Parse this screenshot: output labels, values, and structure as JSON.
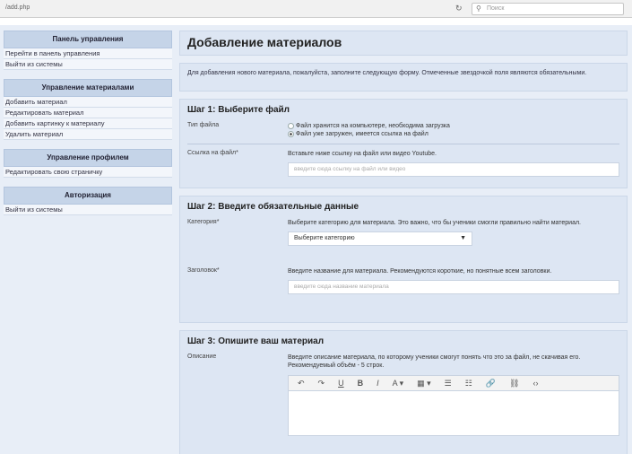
{
  "addressbar": {
    "url": "/add.php",
    "reload_glyph": "↻",
    "search_placeholder": "Поиск"
  },
  "sidebar": {
    "blocks": [
      {
        "title": "Панель управления",
        "items": [
          "Перейти в панель управления",
          "Выйти из системы"
        ]
      },
      {
        "title": "Управление материалами",
        "items": [
          "Добавить материал",
          "Редактировать материал",
          "Добавить картинку к материалу",
          "Удалить материал"
        ]
      },
      {
        "title": "Управление профилем",
        "items": [
          "Редактировать свою страничку"
        ]
      },
      {
        "title": "Авторизация",
        "items": [
          "Выйти из системы"
        ]
      }
    ]
  },
  "main": {
    "title": "Добавление материалов",
    "intro": "Для добавления нового материала, пожалуйста, заполните следующую форму. Отмеченные звездочкой поля являются обязательными.",
    "step1": {
      "title": "Шаг 1: Выберите файл",
      "type_label": "Тип файла",
      "option1": "Файл хранится на компьютере, необходима загрузка",
      "option2": "Файл уже загружен, имеется ссылка на файл",
      "link_label": "Ссылка на файл*",
      "link_hint": "Вставьте ниже ссылку на файл или видео Youtube.",
      "link_placeholder": "введите сюда ссылку на файл или видео"
    },
    "step2": {
      "title": "Шаг 2: Введите обязательные данные",
      "cat_label": "Категория*",
      "cat_hint": "Выберите категорию для материала. Это важно, что бы ученики смогли правильно найти материал.",
      "cat_value": "Выберите категорию",
      "head_label": "Заголовок*",
      "head_hint": "Введите название для материала. Рекомендуются короткие, но понятные всем заголовки.",
      "head_placeholder": "введите сюда название материала"
    },
    "step3": {
      "title": "Шаг 3: Опишите ваш материал",
      "desc_label": "Описание",
      "desc_hint": "Введите описание материала, по которому ученики смогут понять что это за файл, не скачивая его. Рекомендуемый объём - 5 строк."
    },
    "toolbar": {
      "undo": "↶",
      "redo": "↷",
      "underline": "U",
      "bold": "B",
      "italic": "I",
      "font_color": "A ▾",
      "bg_color": "▦ ▾",
      "ul": "☰",
      "ol": "☷",
      "link": "🔗",
      "unlink": "⛓",
      "code": "‹›"
    }
  }
}
